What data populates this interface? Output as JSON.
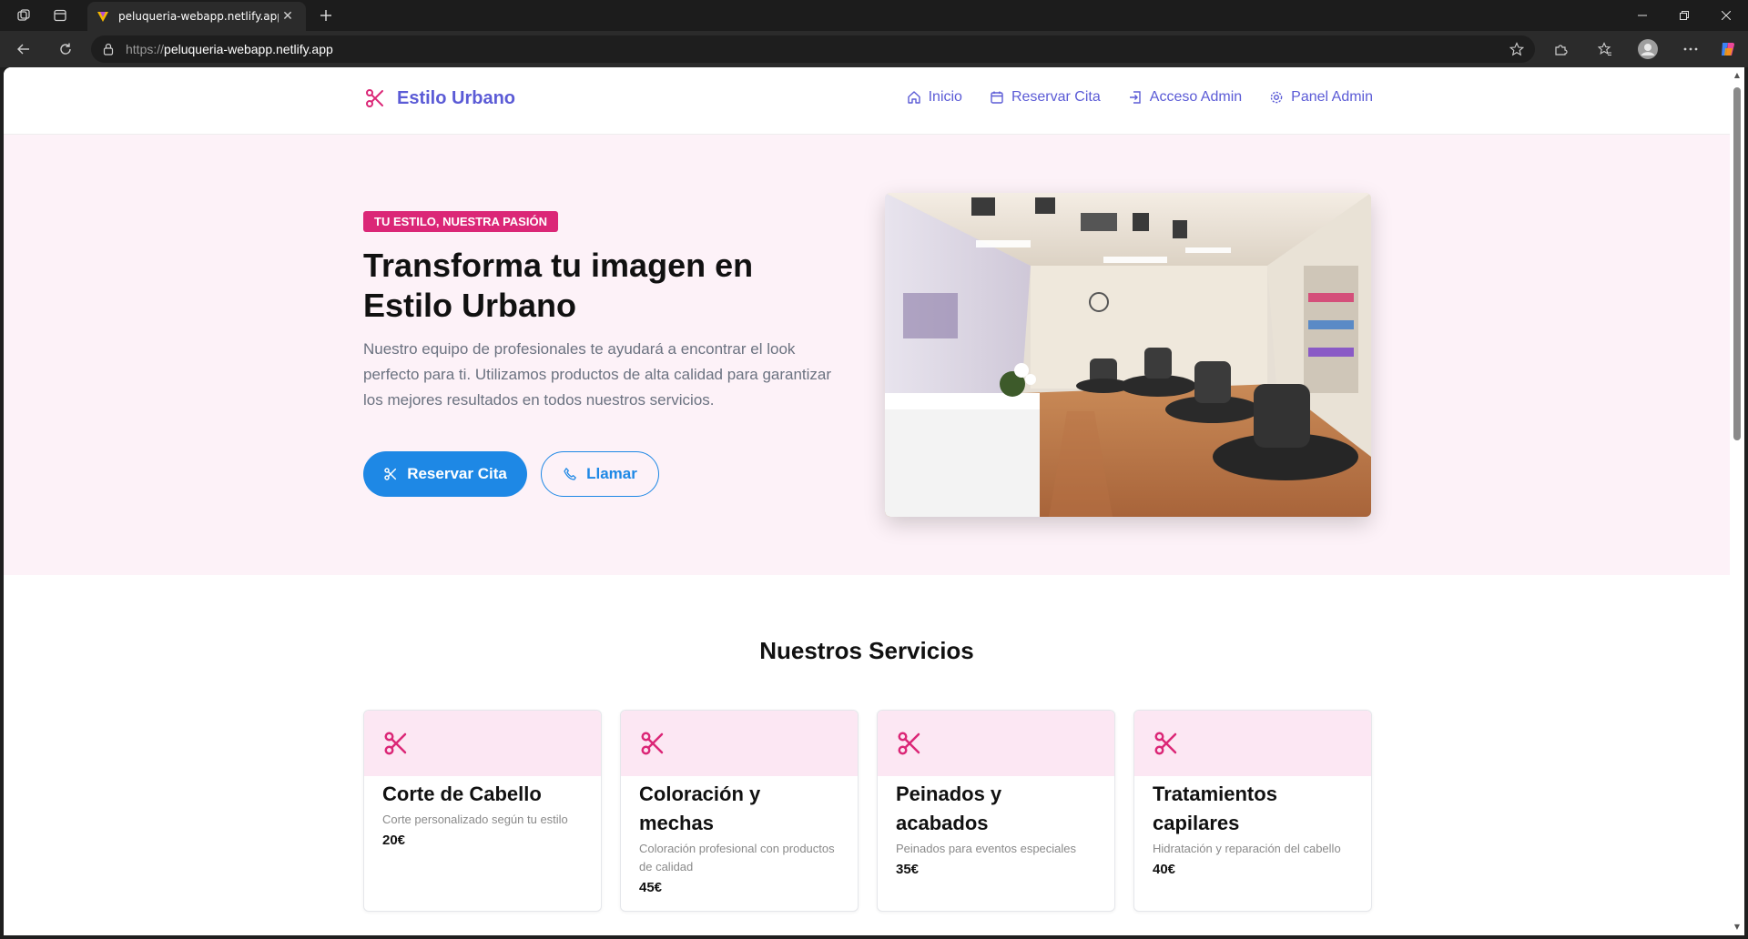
{
  "browser": {
    "tab_title": "peluqueria-webapp.netlify.app",
    "url_scheme": "https://",
    "url_host": "peluqueria-webapp.netlify.app"
  },
  "site": {
    "brand": "Estilo Urbano",
    "nav": [
      {
        "label": "Inicio",
        "icon": "home-icon"
      },
      {
        "label": "Reservar Cita",
        "icon": "calendar-icon"
      },
      {
        "label": "Acceso Admin",
        "icon": "login-icon"
      },
      {
        "label": "Panel Admin",
        "icon": "settings-icon"
      }
    ]
  },
  "hero": {
    "badge": "TU ESTILO, NUESTRA PASIÓN",
    "title": "Transforma tu imagen en Estilo Urbano",
    "description": "Nuestro equipo de profesionales te ayudará a encontrar el look perfecto para ti. Utilizamos productos de alta calidad para garantizar los mejores resultados en todos nuestros servicios.",
    "primary_button": "Reservar Cita",
    "secondary_button": "Llamar"
  },
  "services": {
    "title": "Nuestros Servicios",
    "items": [
      {
        "name": "Corte de Cabello",
        "description": "Corte personalizado según tu estilo",
        "price": "20€"
      },
      {
        "name": "Coloración y mechas",
        "description": "Coloración profesional con productos de calidad",
        "price": "45€"
      },
      {
        "name": "Peinados y acabados",
        "description": "Peinados para eventos especiales",
        "price": "35€"
      },
      {
        "name": "Tratamientos capilares",
        "description": "Hidratación y reparación del cabello",
        "price": "40€"
      }
    ]
  },
  "colors": {
    "brand": "#5b5bd6",
    "accent_pink": "#db2777",
    "primary_blue": "#1e88e5",
    "hero_bg": "#fdf2f8",
    "card_head_bg": "#fce7f3"
  }
}
